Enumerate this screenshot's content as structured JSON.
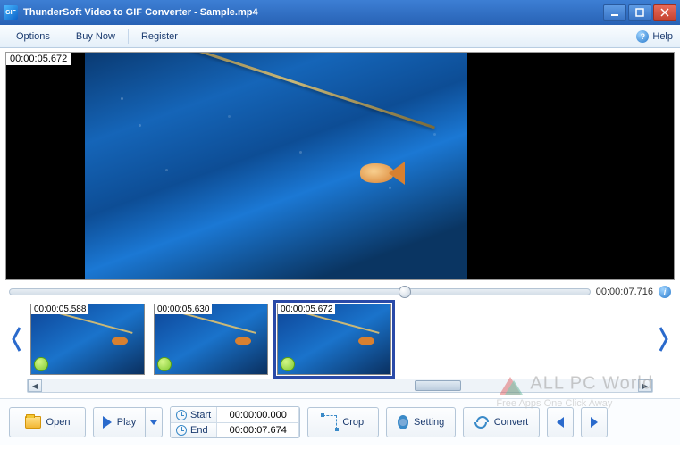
{
  "window": {
    "title": "ThunderSoft Video to GIF Converter - Sample.mp4",
    "app_icon_text": "GIF"
  },
  "menubar": {
    "options": "Options",
    "buy_now": "Buy Now",
    "register": "Register",
    "help": "Help"
  },
  "video": {
    "timestamp": "00:00:05.672"
  },
  "timeline": {
    "total": "00:00:07.716"
  },
  "thumbs": [
    {
      "ts": "00:00:05.588",
      "selected": false
    },
    {
      "ts": "00:00:05.630",
      "selected": false
    },
    {
      "ts": "00:00:05.672",
      "selected": true
    }
  ],
  "time_grid": {
    "start_label": "Start",
    "start_value": "00:00:00.000",
    "end_label": "End",
    "end_value": "00:00:07.674"
  },
  "buttons": {
    "open": "Open",
    "play": "Play",
    "crop": "Crop",
    "setting": "Setting",
    "convert": "Convert"
  },
  "watermark": {
    "title": "ALL PC World",
    "sub": "Free Apps One Click Away"
  }
}
